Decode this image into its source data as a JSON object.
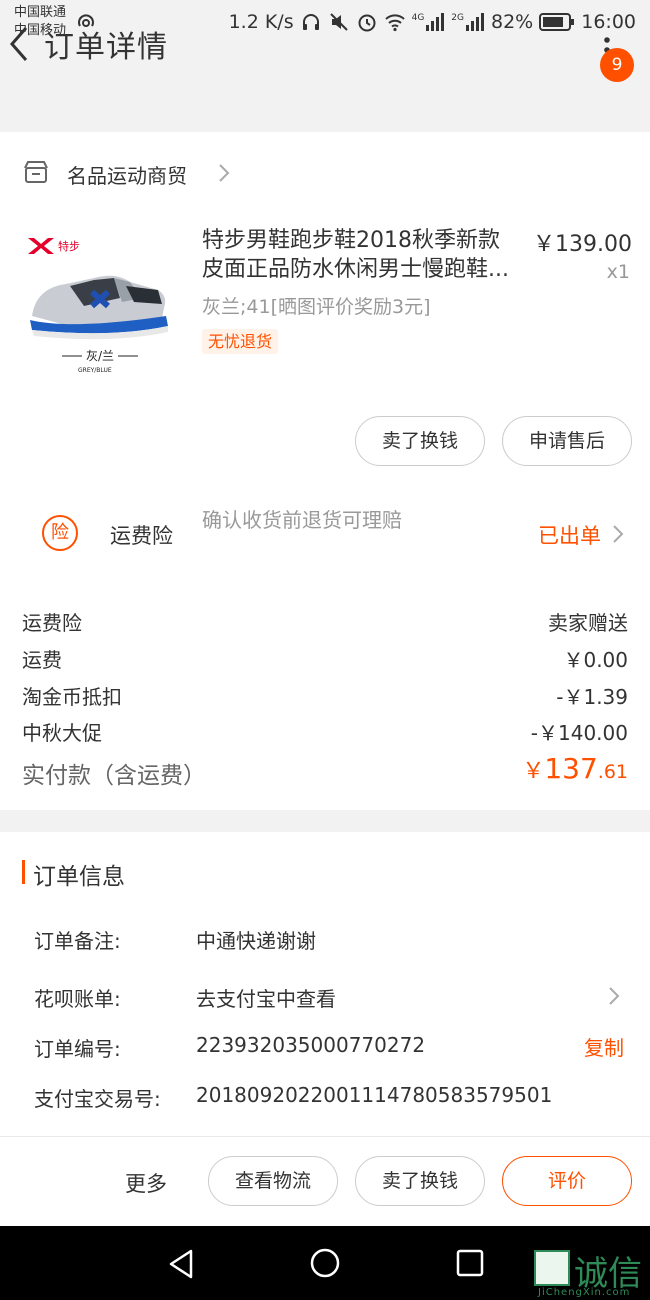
{
  "status_bar": {
    "carrier1": "中国联通",
    "carrier2": "中国移动",
    "speed": "1.2 K/s",
    "net4g": "4G",
    "net2g": "2G",
    "battery": "82%",
    "time": "16:00"
  },
  "header": {
    "title": "订单详情",
    "badge": "9"
  },
  "shop": {
    "name": "名品运动商贸"
  },
  "product": {
    "brand_logo": "特步",
    "image_caption": "灰/兰",
    "image_caption_en": "GREY/BLUE",
    "title_line1": "特步男鞋跑步鞋2018秋季新款",
    "title_line2": "皮面正品防水休闲男士慢跑鞋...",
    "price": "￥139.00",
    "quantity": "x1",
    "spec": "灰兰;41[晒图评价奖励3元]",
    "tag": "无忧退货"
  },
  "item_actions": {
    "sell_exchange": "卖了换钱",
    "apply_aftersale": "申请售后"
  },
  "insurance": {
    "icon_text": "险",
    "label": "运费险",
    "desc": "确认收货前退货可理赔",
    "status": "已出单"
  },
  "fees": [
    {
      "label": "运费险",
      "value": "卖家赠送"
    },
    {
      "label": "运费",
      "value": "￥0.00"
    },
    {
      "label": "淘金币抵扣",
      "value": "-￥1.39"
    },
    {
      "label": "中秋大促",
      "value": "-￥140.00"
    }
  ],
  "total": {
    "label": "实付款（含运费）",
    "currency": "￥",
    "integer": "137",
    "decimal": ".61"
  },
  "order_info": {
    "title": "订单信息",
    "note_label": "订单备注:",
    "note_value": "中通快递谢谢",
    "huabei_label": "花呗账单:",
    "huabei_value": "去支付宝中查看",
    "order_no_label": "订单编号:",
    "order_no_value": "223932035000770272",
    "copy_label": "复制",
    "alipay_label": "支付宝交易号:",
    "alipay_value": "2018092022001114780583579501"
  },
  "bottom_bar": {
    "more": "更多",
    "logistics": "查看物流",
    "sell_exchange": "卖了换钱",
    "review": "评价"
  },
  "watermark": {
    "text": "诚信",
    "sub": "JiChengXin.com"
  },
  "colors": {
    "accent": "#ff5000",
    "background": "#f2f2f2",
    "text": "#333333",
    "muted": "#999999"
  }
}
